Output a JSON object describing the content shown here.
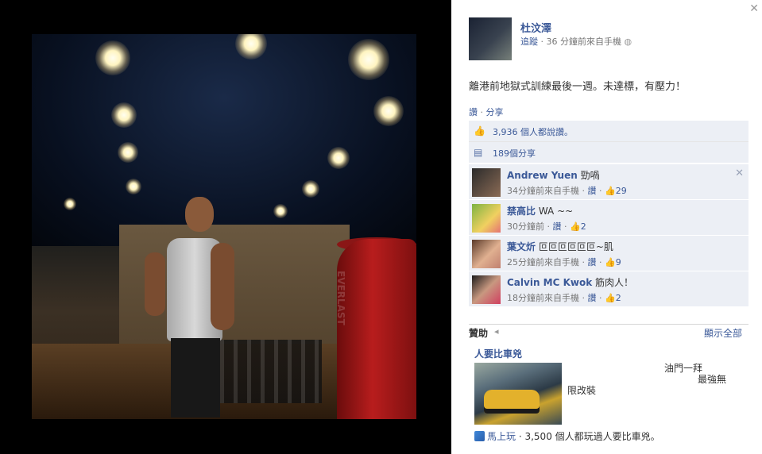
{
  "post": {
    "author": "杜汶澤",
    "follow": "追蹤",
    "time": "36 分鐘前來自手機",
    "privacy_icon": "globe-icon",
    "text": "離港前地獄式訓練最後一週。未達標，有壓力！",
    "like_action": "讚",
    "share_action": "分享",
    "likes_summary": "3,936 個人都說讚。",
    "shares_summary": "189個分享"
  },
  "comments": [
    {
      "name": "Andrew Yuen",
      "text": "勁喎",
      "time": "34分鐘前來自手機",
      "like": "讚",
      "likes": "29"
    },
    {
      "name": "禁高比",
      "text": "WA ~~",
      "time": "30分鐘前",
      "like": "讚",
      "likes": "2"
    },
    {
      "name": "葉文炘",
      "text": "叵叵叵叵叵叵~肌",
      "time": "25分鐘前來自手機",
      "like": "讚",
      "likes": "9"
    },
    {
      "name": "Calvin MC Kwok",
      "text": "筋肉人！",
      "time": "18分鐘前來自手機",
      "like": "讚",
      "likes": "2"
    }
  ],
  "sponsored": {
    "title": "贊助",
    "show_all": "顯示全部",
    "ad_title": "人要比車兇",
    "ad_line1": "油門一拜",
    "ad_line2": "最強無",
    "ad_line3": "限改裝",
    "play_link": "馬上玩",
    "play_text": "3,500 個人都玩過人要比車兇。"
  },
  "photo_sign_text": "EVERLAST",
  "colors": {
    "link": "#3b5998",
    "row_bg": "#eceff5"
  }
}
